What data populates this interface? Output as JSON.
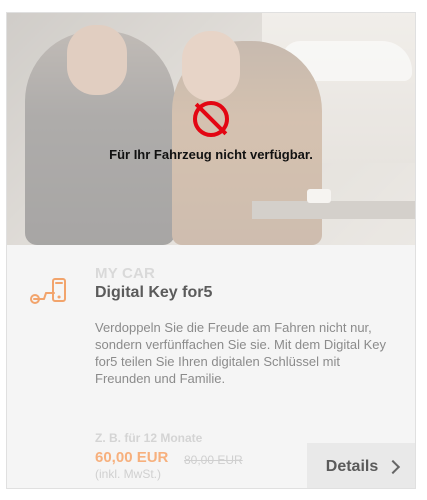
{
  "card": {
    "unavailable_text": "Für Ihr Fahrzeug nicht verfügbar.",
    "category": "MY CAR",
    "title": "Digital Key for5",
    "description": "Verdoppeln Sie die Freude am Fahren nicht nur, sondern verfünffachen Sie sie. Mit dem Digital Key for5 teilen Sie Ihren digitalen Schlüssel mit Freunden und Familie.",
    "price": {
      "label": "Z. B. für 12 Monate",
      "current": "60,00 EUR",
      "old": "80,00 EUR",
      "note": "(inkl. MwSt.)"
    },
    "details_label": "Details"
  },
  "colors": {
    "brand_red": "#e30613",
    "price_accent": "#f7b07d",
    "key_icon": "#f2a46c"
  },
  "icons": {
    "unavailable": "forbidden-icon",
    "key": "car-key-phone-icon",
    "details": "chevron-right-icon"
  }
}
